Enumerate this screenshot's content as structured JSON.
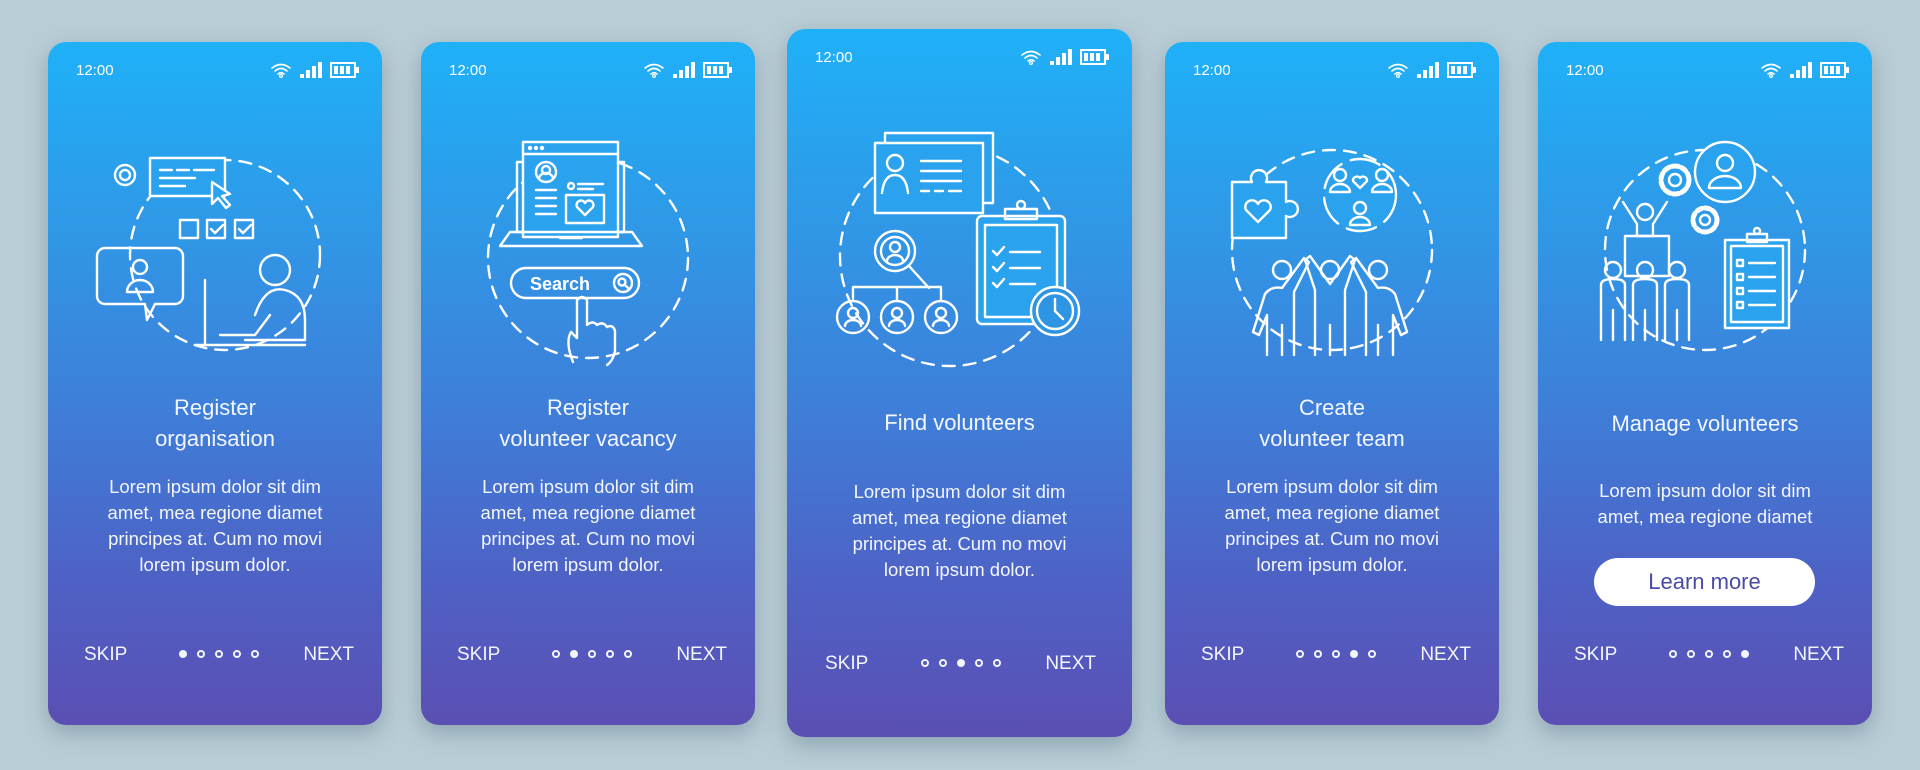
{
  "colors": {
    "background": "#b9cdd6",
    "gradient_top": "#1fb1f8",
    "gradient_bottom": "#5b4fb3",
    "button_text": "#4a4aa8"
  },
  "status_bar": {
    "time": "12:00",
    "icons": [
      "wifi-icon",
      "signal-icon",
      "battery-icon"
    ]
  },
  "nav": {
    "skip_label": "SKIP",
    "next_label": "NEXT",
    "total_pages": 5
  },
  "screens": [
    {
      "illustration": "register-organisation-illustration",
      "title_lines": [
        "Register",
        "organisation"
      ],
      "body_lines": [
        "Lorem ipsum dolor sit dim",
        "amet, mea regione diamet",
        "principes at. Cum no movi",
        "lorem ipsum dolor."
      ],
      "active_page": 1
    },
    {
      "illustration": "register-vacancy-illustration",
      "search_label": "Search",
      "title_lines": [
        "Register",
        "volunteer vacancy"
      ],
      "body_lines": [
        "Lorem ipsum dolor sit dim",
        "amet, mea regione diamet",
        "principes at. Cum no movi",
        "lorem ipsum dolor."
      ],
      "active_page": 2
    },
    {
      "illustration": "find-volunteers-illustration",
      "title_lines": [
        "Find volunteers"
      ],
      "body_lines": [
        "Lorem ipsum dolor sit dim",
        "amet, mea regione diamet",
        "principes at. Cum no movi",
        "lorem ipsum dolor."
      ],
      "active_page": 3
    },
    {
      "illustration": "create-team-illustration",
      "title_lines": [
        "Create",
        "volunteer team"
      ],
      "body_lines": [
        "Lorem ipsum dolor sit dim",
        "amet, mea regione diamet",
        "principes at. Cum no movi",
        "lorem ipsum dolor."
      ],
      "active_page": 4
    },
    {
      "illustration": "manage-volunteers-illustration",
      "title_lines": [
        "Manage volunteers"
      ],
      "body_lines": [
        "Lorem ipsum dolor sit dim",
        "amet, mea regione diamet"
      ],
      "button_label": "Learn more",
      "active_page": 5
    }
  ]
}
